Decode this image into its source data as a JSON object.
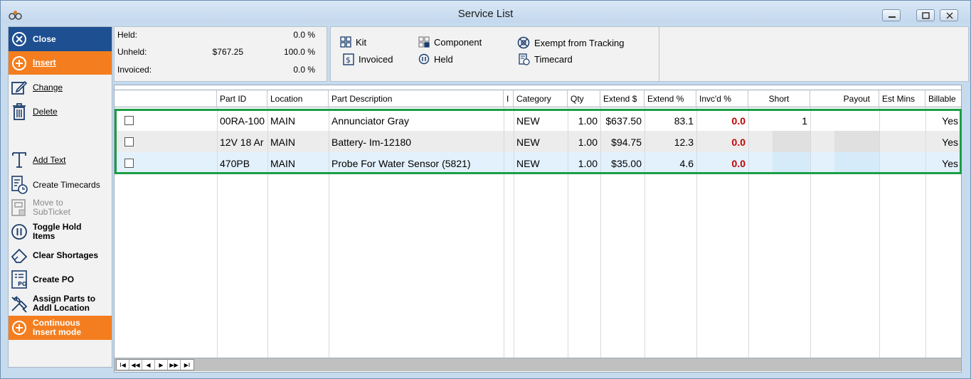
{
  "window": {
    "title": "Service List"
  },
  "sidebar": {
    "items": [
      {
        "label": "Close"
      },
      {
        "label": "Insert"
      },
      {
        "label": "Change"
      },
      {
        "label": "Delete"
      },
      {
        "label": "Add Text"
      },
      {
        "label": "Create Timecards"
      },
      {
        "label": "Move to SubTicket"
      },
      {
        "label": "Toggle Hold Items"
      },
      {
        "label": "Clear Shortages"
      },
      {
        "label": "Create PO"
      },
      {
        "label": "Assign Parts to Addl Location"
      },
      {
        "label": "Continuous Insert mode"
      }
    ]
  },
  "summary": {
    "held": {
      "label": "Held:",
      "amount": "",
      "pct": "0.0 %"
    },
    "unheld": {
      "label": "Unheld:",
      "amount": "$767.25",
      "pct": "100.0 %"
    },
    "invoiced": {
      "label": "Invoiced:",
      "amount": "",
      "pct": "0.0 %"
    }
  },
  "legend": {
    "kit": "Kit",
    "component": "Component",
    "exempt": "Exempt from Tracking",
    "invoiced": "Invoiced",
    "held": "Held",
    "timecard": "Timecard"
  },
  "grid": {
    "headers": {
      "part_id": "Part ID",
      "location": "Location",
      "part_desc": "Part Description",
      "i": "I",
      "category": "Category",
      "qty": "Qty",
      "extend_d": "Extend $",
      "extend_p": "Extend %",
      "invcd": "Invc'd %",
      "short": "Short",
      "payout": "Payout",
      "est_mins": "Est Mins",
      "billable": "Billable"
    },
    "rows": [
      {
        "part_id": "00RA-100",
        "location": "MAIN",
        "desc": "Annunciator Gray",
        "category": "NEW",
        "qty": "1.00",
        "extend_d": "$637.50",
        "extend_p": "83.1",
        "invcd": "0.0",
        "short": "1",
        "billable": "Yes"
      },
      {
        "part_id": "12V 18 Ar",
        "location": "MAIN",
        "desc": "Battery- Im-12180",
        "category": "NEW",
        "qty": "1.00",
        "extend_d": "$94.75",
        "extend_p": "12.3",
        "invcd": "0.0",
        "short": "",
        "billable": "Yes"
      },
      {
        "part_id": "470PB",
        "location": "MAIN",
        "desc": "Probe For Water Sensor (5821)",
        "category": "NEW",
        "qty": "1.00",
        "extend_d": "$35.00",
        "extend_p": "4.6",
        "invcd": "0.0",
        "short": "",
        "billable": "Yes"
      }
    ]
  },
  "navigator": {
    "buttons": [
      "I◀",
      "◀◀",
      "◀",
      "▶",
      "▶▶",
      "▶I"
    ]
  },
  "colors": {
    "accent_blue": "#1d4f91",
    "accent_orange": "#f47e1f",
    "selection_green": "#1a9e45",
    "invoiced_red": "#c00000"
  }
}
